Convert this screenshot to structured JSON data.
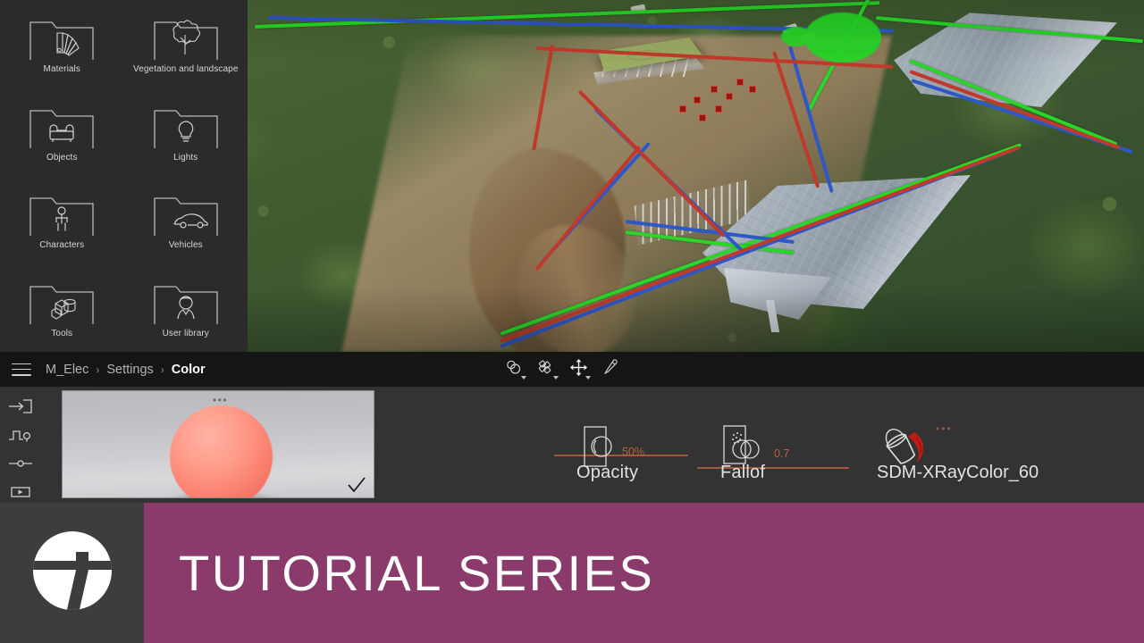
{
  "app": {
    "viewport_name": "3d-viewport-render"
  },
  "library": {
    "panel_name": "asset-library-panel",
    "folders": [
      {
        "label": "Materials",
        "icon": "materials-swatch-icon"
      },
      {
        "label": "Vegetation and landscape",
        "icon": "tree-icon"
      },
      {
        "label": "Objects",
        "icon": "sofa-icon"
      },
      {
        "label": "Lights",
        "icon": "lightbulb-icon"
      },
      {
        "label": "Characters",
        "icon": "person-icon"
      },
      {
        "label": "Vehicles",
        "icon": "car-icon"
      },
      {
        "label": "Tools",
        "icon": "tools-blocks-icon"
      },
      {
        "label": "User library",
        "icon": "user-icon"
      }
    ]
  },
  "breadcrumb": {
    "menu_icon": "hamburger-menu-icon",
    "items": [
      {
        "label": "M_Elec",
        "active": false
      },
      {
        "label": "Settings",
        "active": false
      },
      {
        "label": "Color",
        "active": true
      }
    ],
    "separator": "›"
  },
  "toolbar": {
    "tools": [
      {
        "name": "select-objects-tool",
        "icon": "two-circles-icon",
        "has_dropdown": true
      },
      {
        "name": "paint-pattern-tool",
        "icon": "pattern-tile-icon",
        "has_dropdown": true
      },
      {
        "name": "move-tool",
        "icon": "move-arrows-icon",
        "has_dropdown": true
      },
      {
        "name": "eyedropper-tool",
        "icon": "eyedropper-icon",
        "has_dropdown": false
      }
    ]
  },
  "editor": {
    "rail": [
      {
        "name": "import-icon",
        "label": "Import"
      },
      {
        "name": "bump-profile-icon",
        "label": "Bump"
      },
      {
        "name": "slider-node-icon",
        "label": "Adjust"
      },
      {
        "name": "animate-play-icon",
        "label": "Animate"
      }
    ],
    "preview": {
      "name": "material-preview",
      "dots": "•••",
      "check_icon": "checkmark-icon"
    },
    "controls": [
      {
        "name": "opacity-slider",
        "label": "Opacity",
        "value": "50%",
        "icon": "opacity-half-circle-icon",
        "fill_percent": 50
      },
      {
        "name": "falloff-slider",
        "label": "Fallof",
        "value": "0.7",
        "icon": "falloff-circles-icon",
        "fill_percent": 70
      }
    ],
    "material": {
      "name_label": "SDM-XRayColor_60",
      "icon": "paint-bucket-icon",
      "dots": "•••"
    }
  },
  "banner": {
    "title": "TUTORIAL SERIES",
    "logo": "t-circle-logo",
    "background_color": "#8a3a6b",
    "logo_box_color": "#3d3d3d"
  },
  "colors": {
    "panel_bg": "#2b2b2b",
    "crumb_bar_bg": "#151515",
    "editor_bg": "#333333",
    "accent_orange": "#a3583b",
    "accent_value": "#b5613f",
    "banner_purple": "#8a3a6b"
  }
}
